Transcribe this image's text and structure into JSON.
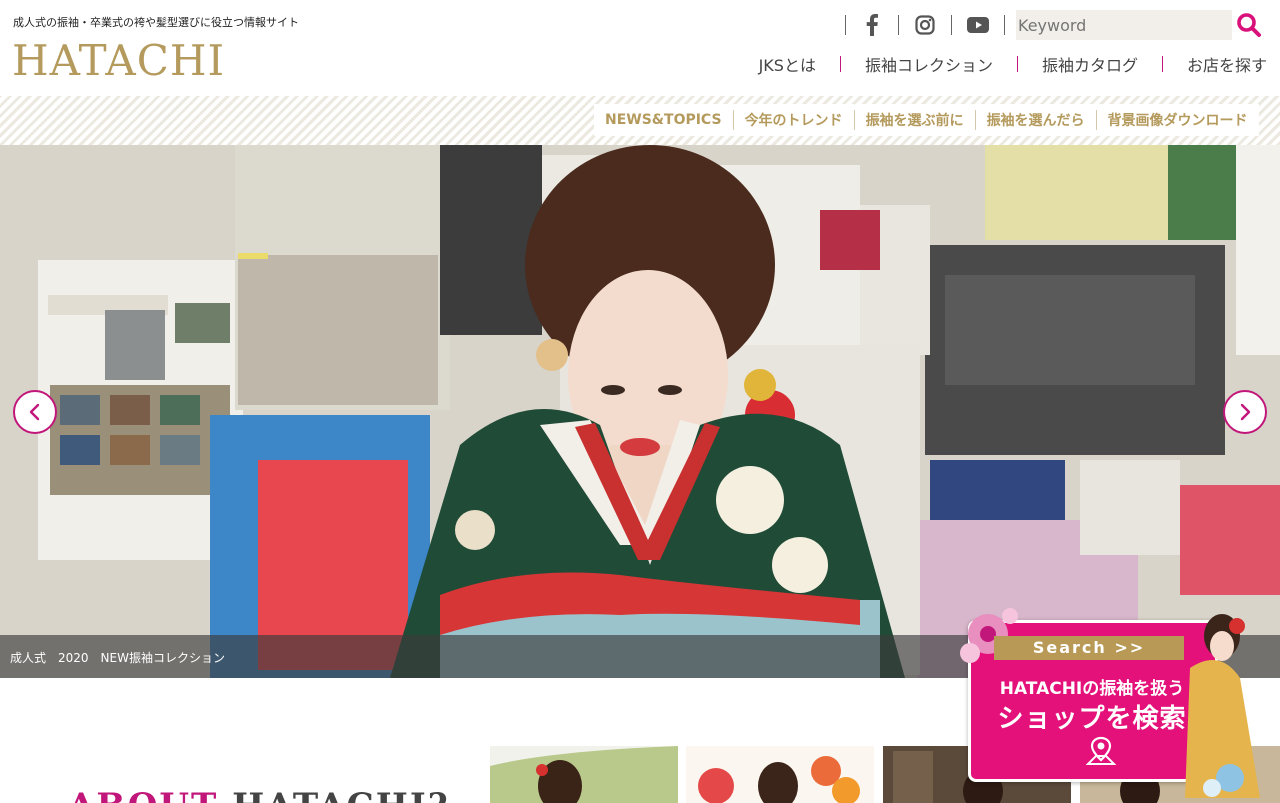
{
  "header": {
    "tagline": "成人式の振袖・卒業式の袴や髪型選びに役立つ情報サイト",
    "logo": "HATACHI",
    "social_icons": [
      "facebook-icon",
      "instagram-icon",
      "youtube-icon"
    ],
    "search_placeholder": "Keyword",
    "search_icon": "search-icon"
  },
  "main_nav": [
    {
      "label": "JKSとは"
    },
    {
      "label": "振袖コレクション"
    },
    {
      "label": "振袖カタログ"
    },
    {
      "label": "お店を探す"
    }
  ],
  "sub_nav": [
    {
      "label": "NEWS&TOPICS"
    },
    {
      "label": "今年のトレンド"
    },
    {
      "label": "振袖を選ぶ前に"
    },
    {
      "label": "振袖を選んだら"
    },
    {
      "label": "背景画像ダウンロード"
    }
  ],
  "hero": {
    "caption": "成人式　2020　NEW振袖コレクション",
    "prev_icon": "chevron-left-icon",
    "next_icon": "chevron-right-icon"
  },
  "search_badge": {
    "heading": "Search >>",
    "line1": "HATACHIの振袖を扱う",
    "line2": "ショップを検索"
  },
  "about": {
    "part1": "ABOUT",
    "part2": "HATACHI?"
  },
  "colors": {
    "gold": "#b49a5c",
    "magenta": "#c2177a",
    "badge_pink": "#e4117a"
  }
}
